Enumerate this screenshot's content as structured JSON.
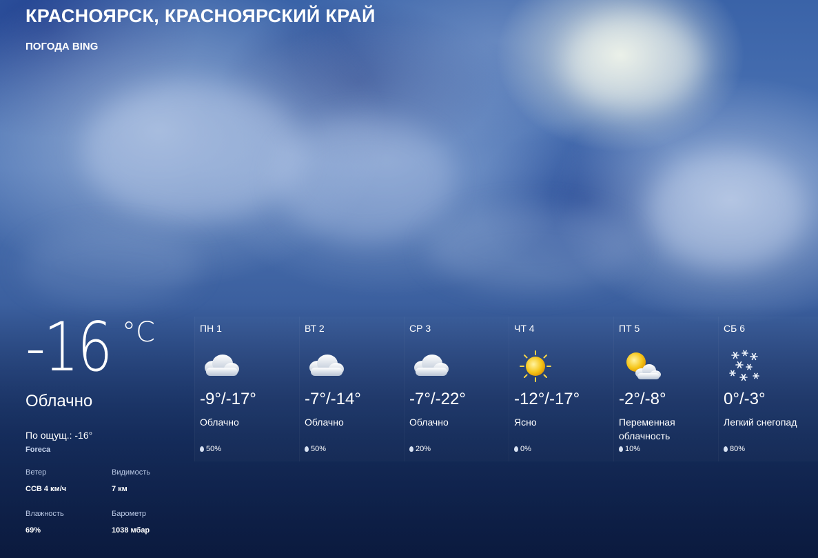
{
  "header": {
    "location": "КРАСНОЯРСК, КРАСНОЯРСКИЙ КРАЙ",
    "source": "ПОГОДА BING"
  },
  "current": {
    "temperature": "-16",
    "unit": "°C",
    "condition": "Облачно",
    "feels_like": "По ощущ.: -16°",
    "provider": "Foreca",
    "wind_label": "Ветер",
    "wind_value": "ССВ 4 км/ч",
    "visibility_label": "Видимость",
    "visibility_value": "7 км",
    "humidity_label": "Влажность",
    "humidity_value": "69%",
    "barometer_label": "Барометр",
    "barometer_value": "1038 мбар"
  },
  "forecast": [
    {
      "day": "ПН 1",
      "icon": "cloudy-icon",
      "temp": "-9°/-17°",
      "condition": "Облачно",
      "precip": "50%"
    },
    {
      "day": "ВТ 2",
      "icon": "cloudy-icon",
      "temp": "-7°/-14°",
      "condition": "Облачно",
      "precip": "50%"
    },
    {
      "day": "СР 3",
      "icon": "cloudy-icon",
      "temp": "-7°/-22°",
      "condition": "Облачно",
      "precip": "20%"
    },
    {
      "day": "ЧТ 4",
      "icon": "sun-icon",
      "temp": "-12°/-17°",
      "condition": "Ясно",
      "precip": "0%"
    },
    {
      "day": "ПТ 5",
      "icon": "partly-cloudy-icon",
      "temp": "-2°/-8°",
      "condition": "Переменная облачность",
      "precip": "10%"
    },
    {
      "day": "СБ 6",
      "icon": "snow-icon",
      "temp": "0°/-3°",
      "condition": "Легкий снегопад",
      "precip": "80%"
    }
  ],
  "colors": {
    "sky_top": "#3a63a8",
    "sky_bottom": "#0f2350",
    "text": "#ffffff",
    "sun": "#f5c518"
  }
}
